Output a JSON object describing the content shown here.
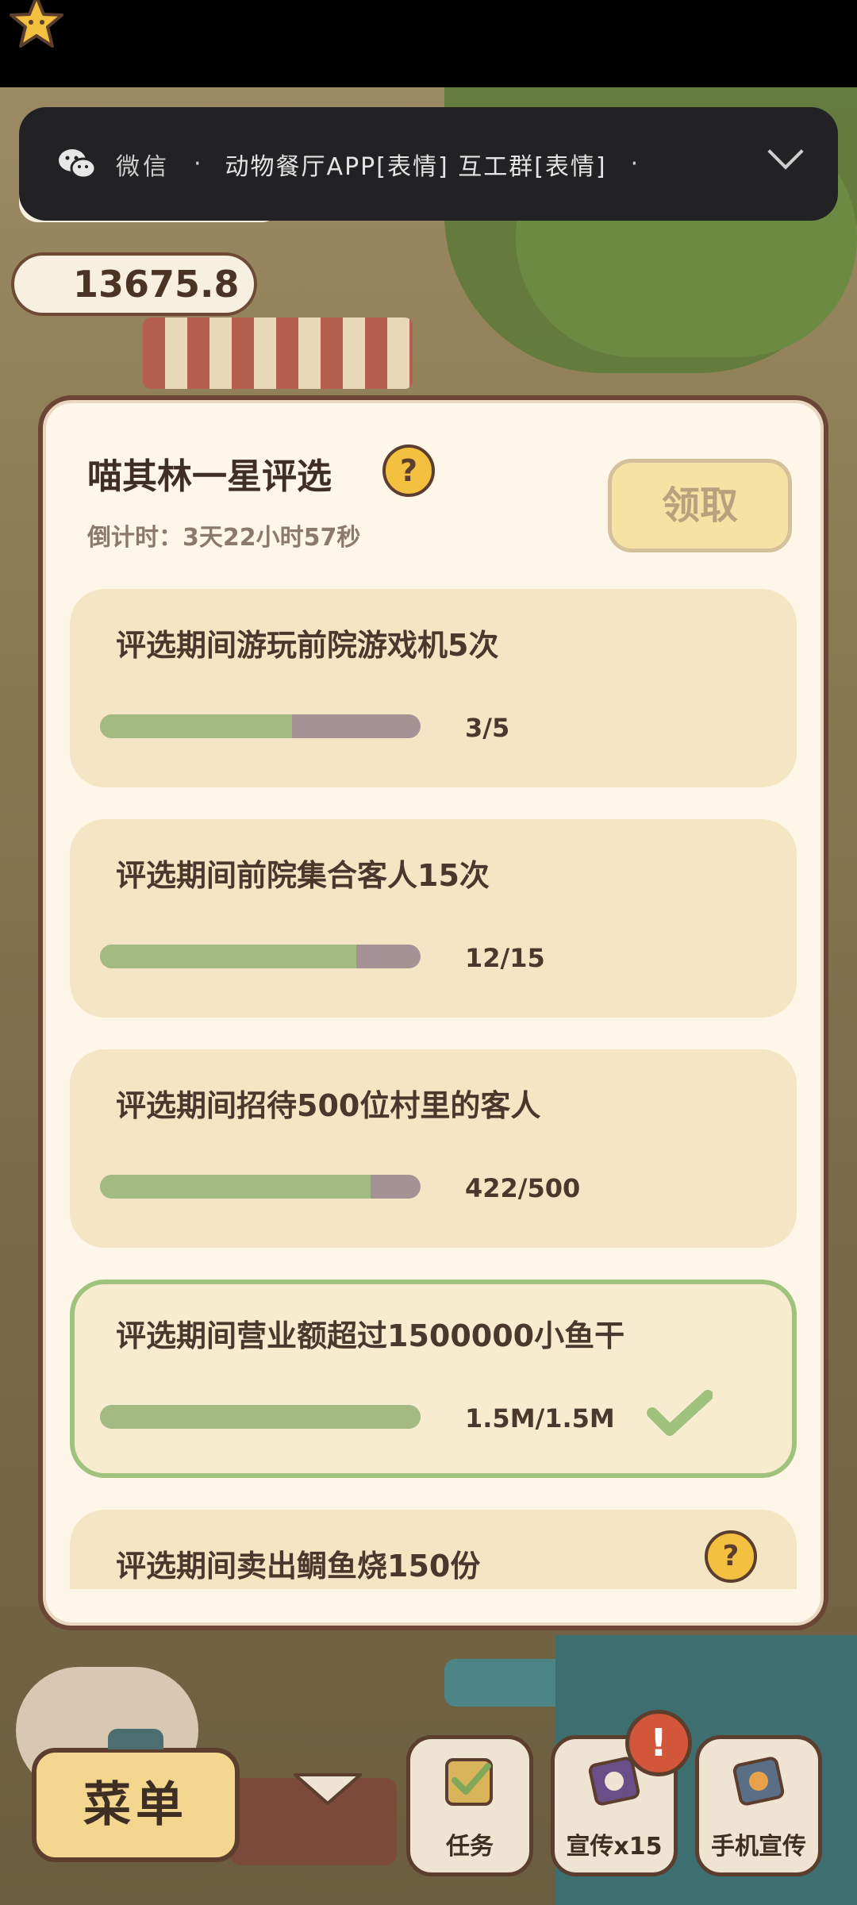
{
  "notification": {
    "app_name": "微信",
    "separator": "·",
    "message": "动物餐厅APP[表情] 互工群[表情]",
    "trailing_separator": "·"
  },
  "currency": {
    "stars": "13675.8"
  },
  "modal": {
    "title": "喵其林一星评选",
    "countdown": "倒计时：3天22小时57秒",
    "claim_button": "领取",
    "tasks": [
      {
        "title": "评选期间游玩前院游戏机5次",
        "progress_text": "3/5",
        "progress": 0.6,
        "completed": false
      },
      {
        "title": "评选期间前院集合客人15次",
        "progress_text": "12/15",
        "progress": 0.8,
        "completed": false
      },
      {
        "title": "评选期间招待500位村里的客人",
        "progress_text": "422/500",
        "progress": 0.844,
        "completed": false
      },
      {
        "title": "评选期间营业额超过1500000小鱼干",
        "progress_text": "1.5M/1.5M",
        "progress": 1.0,
        "completed": true
      },
      {
        "title": "评选期间卖出鲷鱼烧150份",
        "progress_text": "",
        "progress": 0,
        "completed": false
      }
    ]
  },
  "bottom_bar": {
    "menu": "菜单",
    "tasks": "任务",
    "promo": "宣传x15",
    "phone_promo": "手机宣传",
    "alert_badge": "!"
  },
  "colors": {
    "bar_fill": "#a3bb82",
    "bar_track": "#a59294",
    "card_bg": "#f4e6c4",
    "done_border": "#9fc27d",
    "accent_yellow": "#f3c040"
  }
}
